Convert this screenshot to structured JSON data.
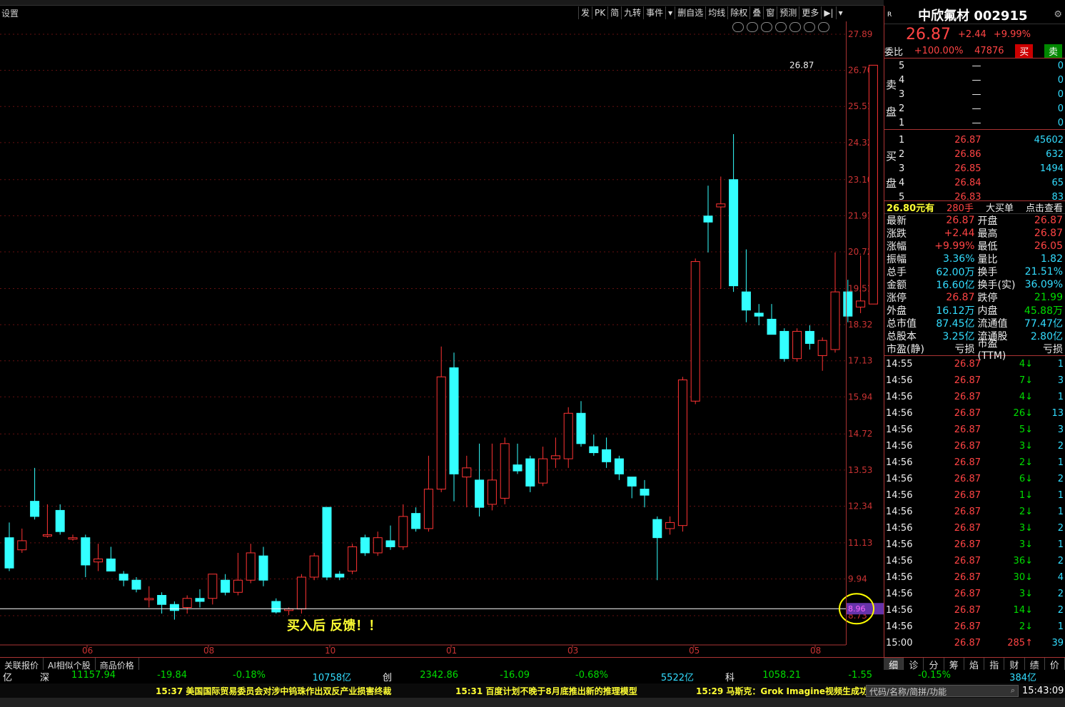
{
  "header": {
    "settings_label": "设置"
  },
  "toolbar": [
    "发",
    "PK",
    "简",
    "九转",
    "事件",
    "▾",
    "删自选",
    "均线",
    "除权",
    "叠",
    "窗",
    "预测",
    "更多",
    "▶|",
    "▾"
  ],
  "chart_data": {
    "type": "candlestick",
    "y_ticks": [
      "27.89",
      "26.70",
      "25.51",
      "24.32",
      "23.10",
      "21.91",
      "20.72",
      "19.51",
      "18.32",
      "17.13",
      "15.94",
      "14.72",
      "13.53",
      "12.34",
      "11.13",
      "9.94",
      "8.73"
    ],
    "x_ticks": [
      "06",
      "08",
      "10",
      "01",
      "03",
      "05",
      "08"
    ],
    "last_price_label": "26.87",
    "highlight_price": "8.96",
    "annotation": "买入后   反馈！！",
    "candles": [
      {
        "o": 11.3,
        "c": 10.3,
        "h": 11.8,
        "l": 10.2
      },
      {
        "o": 10.9,
        "c": 11.2,
        "h": 11.6,
        "l": 10.8
      },
      {
        "o": 12.5,
        "c": 12.0,
        "h": 13.6,
        "l": 11.9
      },
      {
        "o": 11.4,
        "c": 11.4,
        "h": 12.4,
        "l": 11.3
      },
      {
        "o": 12.2,
        "c": 11.5,
        "h": 12.4,
        "l": 11.4
      },
      {
        "o": 11.3,
        "c": 11.3,
        "h": 11.4,
        "l": 11.2
      },
      {
        "o": 11.3,
        "c": 10.4,
        "h": 11.4,
        "l": 10.0
      },
      {
        "o": 10.5,
        "c": 10.6,
        "h": 11.1,
        "l": 10.2
      },
      {
        "o": 10.6,
        "c": 10.2,
        "h": 11.0,
        "l": 10.2
      },
      {
        "o": 10.1,
        "c": 9.9,
        "h": 10.2,
        "l": 9.7
      },
      {
        "o": 9.9,
        "c": 9.6,
        "h": 10.0,
        "l": 9.5
      },
      {
        "o": 9.3,
        "c": 9.3,
        "h": 9.7,
        "l": 9.0
      },
      {
        "o": 9.4,
        "c": 9.1,
        "h": 9.5,
        "l": 8.8
      },
      {
        "o": 9.1,
        "c": 8.9,
        "h": 9.2,
        "l": 8.6
      },
      {
        "o": 9.0,
        "c": 9.3,
        "h": 9.4,
        "l": 8.8
      },
      {
        "o": 9.3,
        "c": 9.2,
        "h": 9.6,
        "l": 9.0
      },
      {
        "o": 9.3,
        "c": 10.1,
        "h": 10.1,
        "l": 9.1
      },
      {
        "o": 9.9,
        "c": 9.5,
        "h": 10.1,
        "l": 9.4
      },
      {
        "o": 9.5,
        "c": 9.9,
        "h": 10.8,
        "l": 9.4
      },
      {
        "o": 9.9,
        "c": 10.8,
        "h": 11.1,
        "l": 9.8
      },
      {
        "o": 10.7,
        "c": 9.9,
        "h": 11.0,
        "l": 9.7
      },
      {
        "o": 9.2,
        "c": 8.85,
        "h": 9.3,
        "l": 8.8
      },
      {
        "o": 8.9,
        "c": 8.95,
        "h": 9.0,
        "l": 8.75
      },
      {
        "o": 8.95,
        "c": 10.0,
        "h": 10.1,
        "l": 8.8
      },
      {
        "o": 10.0,
        "c": 10.7,
        "h": 10.8,
        "l": 9.9
      },
      {
        "o": 12.3,
        "c": 10.0,
        "h": 12.3,
        "l": 9.9
      },
      {
        "o": 10.1,
        "c": 10.0,
        "h": 10.2,
        "l": 9.9
      },
      {
        "o": 10.2,
        "c": 11.0,
        "h": 11.1,
        "l": 10.1
      },
      {
        "o": 11.3,
        "c": 10.8,
        "h": 11.4,
        "l": 10.7
      },
      {
        "o": 10.8,
        "c": 11.3,
        "h": 11.5,
        "l": 10.7
      },
      {
        "o": 11.2,
        "c": 11.0,
        "h": 11.7,
        "l": 10.9
      },
      {
        "o": 11.0,
        "c": 12.0,
        "h": 12.4,
        "l": 10.9
      },
      {
        "o": 12.1,
        "c": 11.6,
        "h": 12.3,
        "l": 11.5
      },
      {
        "o": 11.6,
        "c": 12.9,
        "h": 14.0,
        "l": 11.5
      },
      {
        "o": 12.9,
        "c": 16.6,
        "h": 17.6,
        "l": 12.8
      },
      {
        "o": 16.9,
        "c": 13.4,
        "h": 17.4,
        "l": 12.5
      },
      {
        "o": 13.3,
        "c": 13.6,
        "h": 14.0,
        "l": 12.3
      },
      {
        "o": 13.2,
        "c": 12.3,
        "h": 14.4,
        "l": 12.0
      },
      {
        "o": 12.4,
        "c": 13.2,
        "h": 14.4,
        "l": 12.2
      },
      {
        "o": 12.6,
        "c": 14.4,
        "h": 14.6,
        "l": 12.4
      },
      {
        "o": 13.7,
        "c": 13.5,
        "h": 14.4,
        "l": 13.4
      },
      {
        "o": 13.9,
        "c": 13.0,
        "h": 14.0,
        "l": 12.8
      },
      {
        "o": 13.1,
        "c": 13.9,
        "h": 14.3,
        "l": 13.0
      },
      {
        "o": 13.9,
        "c": 14.0,
        "h": 14.6,
        "l": 13.6
      },
      {
        "o": 13.9,
        "c": 15.4,
        "h": 15.6,
        "l": 13.6
      },
      {
        "o": 15.4,
        "c": 14.4,
        "h": 15.8,
        "l": 14.3
      },
      {
        "o": 14.3,
        "c": 14.1,
        "h": 14.7,
        "l": 14.0
      },
      {
        "o": 14.2,
        "c": 13.8,
        "h": 14.6,
        "l": 13.6
      },
      {
        "o": 13.9,
        "c": 13.4,
        "h": 14.0,
        "l": 13.2
      },
      {
        "o": 13.3,
        "c": 13.0,
        "h": 13.3,
        "l": 12.6
      },
      {
        "o": 12.9,
        "c": 12.7,
        "h": 13.2,
        "l": 12.3
      },
      {
        "o": 11.9,
        "c": 11.3,
        "h": 12.0,
        "l": 9.9
      },
      {
        "o": 11.6,
        "c": 11.8,
        "h": 12.0,
        "l": 11.4
      },
      {
        "o": 11.7,
        "c": 16.5,
        "h": 16.6,
        "l": 11.5
      },
      {
        "o": 15.8,
        "c": 20.4,
        "h": 20.5,
        "l": 15.7
      },
      {
        "o": 21.9,
        "c": 21.7,
        "h": 22.9,
        "l": 20.7
      },
      {
        "o": 22.2,
        "c": 22.3,
        "h": 23.2,
        "l": 19.5
      },
      {
        "o": 23.1,
        "c": 19.6,
        "h": 24.6,
        "l": 19.4
      },
      {
        "o": 19.4,
        "c": 18.8,
        "h": 20.8,
        "l": 18.4
      },
      {
        "o": 18.7,
        "c": 18.6,
        "h": 19.0,
        "l": 18.3
      },
      {
        "o": 18.5,
        "c": 18.0,
        "h": 19.0,
        "l": 18.0
      },
      {
        "o": 18.1,
        "c": 17.2,
        "h": 18.2,
        "l": 17.1
      },
      {
        "o": 17.2,
        "c": 18.1,
        "h": 18.2,
        "l": 17.1
      },
      {
        "o": 18.1,
        "c": 17.7,
        "h": 18.3,
        "l": 17.5
      },
      {
        "o": 17.3,
        "c": 17.8,
        "h": 17.9,
        "l": 16.8
      },
      {
        "o": 17.5,
        "c": 19.4,
        "h": 20.7,
        "l": 17.4
      },
      {
        "o": 19.4,
        "c": 18.6,
        "h": 19.8,
        "l": 18.4
      },
      {
        "o": 18.9,
        "c": 19.1,
        "h": 20.6,
        "l": 18.7
      },
      {
        "o": 19.0,
        "c": 26.87,
        "h": 26.87,
        "l": 19.0
      }
    ]
  },
  "quote": {
    "badge": "R",
    "name": "中欣氟材",
    "code": "002915",
    "price": "26.87",
    "change": "+2.44",
    "pct": "+9.99%",
    "weibi_label": "委比",
    "weibi": "+100.00%",
    "weicha": "47876",
    "buy_btn": "买",
    "sell_btn": "卖",
    "sell_label_1": "卖",
    "sell_label_2": "盘",
    "buy_label_1": "买",
    "buy_label_2": "盘",
    "sells": [
      {
        "lv": "5",
        "price": "—",
        "vol": "0"
      },
      {
        "lv": "4",
        "price": "—",
        "vol": "0"
      },
      {
        "lv": "3",
        "price": "—",
        "vol": "0"
      },
      {
        "lv": "2",
        "price": "—",
        "vol": "0"
      },
      {
        "lv": "1",
        "price": "—",
        "vol": "0"
      }
    ],
    "buys": [
      {
        "lv": "1",
        "price": "26.87",
        "vol": "45602"
      },
      {
        "lv": "2",
        "price": "26.86",
        "vol": "632"
      },
      {
        "lv": "3",
        "price": "26.85",
        "vol": "1494"
      },
      {
        "lv": "4",
        "price": "26.84",
        "vol": "65"
      },
      {
        "lv": "5",
        "price": "26.83",
        "vol": "83"
      }
    ],
    "big_order": {
      "price": "26.80元有",
      "vol": "280手",
      "label": "大买单",
      "link": "点击查看"
    },
    "stats": [
      [
        "最新",
        "26.87",
        "开盘",
        "26.87"
      ],
      [
        "涨跌",
        "+2.44",
        "最高",
        "26.87"
      ],
      [
        "涨幅",
        "+9.99%",
        "最低",
        "26.05"
      ],
      [
        "振幅",
        "3.36%",
        "量比",
        "1.82"
      ],
      [
        "总手",
        "62.00万",
        "换手",
        "21.51%"
      ],
      [
        "金额",
        "16.60亿",
        "换手(实)",
        "36.09%"
      ],
      [
        "涨停",
        "26.87",
        "跌停",
        "21.99"
      ],
      [
        "外盘",
        "16.12万",
        "内盘",
        "45.88万"
      ],
      [
        "总市值",
        "87.45亿",
        "流通值",
        "77.47亿"
      ],
      [
        "总股本",
        "3.25亿",
        "流通股",
        "2.80亿"
      ],
      [
        "市盈(静)",
        "亏损",
        "市盈(TTM)",
        "亏损"
      ]
    ],
    "ticks": [
      [
        "14:55",
        "26.87",
        "4",
        "1"
      ],
      [
        "14:56",
        "26.87",
        "7",
        "3"
      ],
      [
        "14:56",
        "26.87",
        "4",
        "1"
      ],
      [
        "14:56",
        "26.87",
        "26",
        "13"
      ],
      [
        "14:56",
        "26.87",
        "5",
        "3"
      ],
      [
        "14:56",
        "26.87",
        "3",
        "2"
      ],
      [
        "14:56",
        "26.87",
        "2",
        "1"
      ],
      [
        "14:56",
        "26.87",
        "6",
        "2"
      ],
      [
        "14:56",
        "26.87",
        "1",
        "1"
      ],
      [
        "14:56",
        "26.87",
        "2",
        "1"
      ],
      [
        "14:56",
        "26.87",
        "3",
        "2"
      ],
      [
        "14:56",
        "26.87",
        "3",
        "1"
      ],
      [
        "14:56",
        "26.87",
        "36",
        "2"
      ],
      [
        "14:56",
        "26.87",
        "30",
        "4"
      ],
      [
        "14:56",
        "26.87",
        "3",
        "2"
      ],
      [
        "14:56",
        "26.87",
        "14",
        "2"
      ],
      [
        "14:56",
        "26.87",
        "2",
        "1"
      ],
      [
        "15:00",
        "26.87",
        "285",
        "39"
      ]
    ]
  },
  "bottom_tabs": [
    "关联报价",
    "AI相似个股",
    "商品价格"
  ],
  "right_tabs": [
    "细",
    "诊",
    "分",
    "筹",
    "焰",
    "指",
    "财",
    "绩",
    "价"
  ],
  "indices": [
    {
      "name": "亿",
      "value": "",
      "chg": "",
      "pct": "",
      "amt": ""
    },
    {
      "name": "深",
      "value": "11157.94",
      "chg": "-19.84",
      "pct": "-0.18%",
      "amt": "10758亿"
    },
    {
      "name": "创",
      "value": "2342.86",
      "chg": "-16.09",
      "pct": "-0.68%",
      "amt": "5522亿"
    },
    {
      "name": "科",
      "value": "1058.21",
      "chg": "-1.55",
      "pct": "-0.15%",
      "amt": "384亿"
    }
  ],
  "news": [
    "15:37 美国国际贸易委员会对涉中钨珠作出双反产业损害终裁",
    "15:31 百度计划不晚于8月底推出新的推理模型",
    "15:29 马斯克：Grok Imagine视频生成功"
  ],
  "search_placeholder": "代码/名称/简拼/功能",
  "clock": "15:43:09"
}
